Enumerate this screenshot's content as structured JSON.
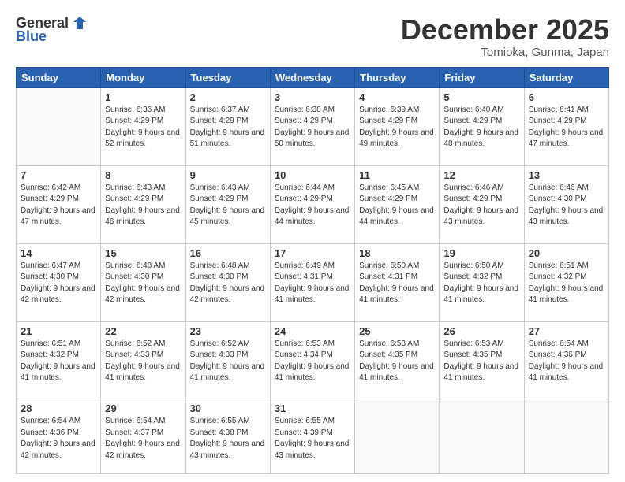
{
  "header": {
    "logo_general": "General",
    "logo_blue": "Blue",
    "month_title": "December 2025",
    "location": "Tomioka, Gunma, Japan"
  },
  "days_of_week": [
    "Sunday",
    "Monday",
    "Tuesday",
    "Wednesday",
    "Thursday",
    "Friday",
    "Saturday"
  ],
  "weeks": [
    [
      {
        "num": "",
        "sunrise": "",
        "sunset": "",
        "daylight": ""
      },
      {
        "num": "1",
        "sunrise": "Sunrise: 6:36 AM",
        "sunset": "Sunset: 4:29 PM",
        "daylight": "Daylight: 9 hours and 52 minutes."
      },
      {
        "num": "2",
        "sunrise": "Sunrise: 6:37 AM",
        "sunset": "Sunset: 4:29 PM",
        "daylight": "Daylight: 9 hours and 51 minutes."
      },
      {
        "num": "3",
        "sunrise": "Sunrise: 6:38 AM",
        "sunset": "Sunset: 4:29 PM",
        "daylight": "Daylight: 9 hours and 50 minutes."
      },
      {
        "num": "4",
        "sunrise": "Sunrise: 6:39 AM",
        "sunset": "Sunset: 4:29 PM",
        "daylight": "Daylight: 9 hours and 49 minutes."
      },
      {
        "num": "5",
        "sunrise": "Sunrise: 6:40 AM",
        "sunset": "Sunset: 4:29 PM",
        "daylight": "Daylight: 9 hours and 48 minutes."
      },
      {
        "num": "6",
        "sunrise": "Sunrise: 6:41 AM",
        "sunset": "Sunset: 4:29 PM",
        "daylight": "Daylight: 9 hours and 47 minutes."
      }
    ],
    [
      {
        "num": "7",
        "sunrise": "Sunrise: 6:42 AM",
        "sunset": "Sunset: 4:29 PM",
        "daylight": "Daylight: 9 hours and 47 minutes."
      },
      {
        "num": "8",
        "sunrise": "Sunrise: 6:43 AM",
        "sunset": "Sunset: 4:29 PM",
        "daylight": "Daylight: 9 hours and 46 minutes."
      },
      {
        "num": "9",
        "sunrise": "Sunrise: 6:43 AM",
        "sunset": "Sunset: 4:29 PM",
        "daylight": "Daylight: 9 hours and 45 minutes."
      },
      {
        "num": "10",
        "sunrise": "Sunrise: 6:44 AM",
        "sunset": "Sunset: 4:29 PM",
        "daylight": "Daylight: 9 hours and 44 minutes."
      },
      {
        "num": "11",
        "sunrise": "Sunrise: 6:45 AM",
        "sunset": "Sunset: 4:29 PM",
        "daylight": "Daylight: 9 hours and 44 minutes."
      },
      {
        "num": "12",
        "sunrise": "Sunrise: 6:46 AM",
        "sunset": "Sunset: 4:29 PM",
        "daylight": "Daylight: 9 hours and 43 minutes."
      },
      {
        "num": "13",
        "sunrise": "Sunrise: 6:46 AM",
        "sunset": "Sunset: 4:30 PM",
        "daylight": "Daylight: 9 hours and 43 minutes."
      }
    ],
    [
      {
        "num": "14",
        "sunrise": "Sunrise: 6:47 AM",
        "sunset": "Sunset: 4:30 PM",
        "daylight": "Daylight: 9 hours and 42 minutes."
      },
      {
        "num": "15",
        "sunrise": "Sunrise: 6:48 AM",
        "sunset": "Sunset: 4:30 PM",
        "daylight": "Daylight: 9 hours and 42 minutes."
      },
      {
        "num": "16",
        "sunrise": "Sunrise: 6:48 AM",
        "sunset": "Sunset: 4:30 PM",
        "daylight": "Daylight: 9 hours and 42 minutes."
      },
      {
        "num": "17",
        "sunrise": "Sunrise: 6:49 AM",
        "sunset": "Sunset: 4:31 PM",
        "daylight": "Daylight: 9 hours and 41 minutes."
      },
      {
        "num": "18",
        "sunrise": "Sunrise: 6:50 AM",
        "sunset": "Sunset: 4:31 PM",
        "daylight": "Daylight: 9 hours and 41 minutes."
      },
      {
        "num": "19",
        "sunrise": "Sunrise: 6:50 AM",
        "sunset": "Sunset: 4:32 PM",
        "daylight": "Daylight: 9 hours and 41 minutes."
      },
      {
        "num": "20",
        "sunrise": "Sunrise: 6:51 AM",
        "sunset": "Sunset: 4:32 PM",
        "daylight": "Daylight: 9 hours and 41 minutes."
      }
    ],
    [
      {
        "num": "21",
        "sunrise": "Sunrise: 6:51 AM",
        "sunset": "Sunset: 4:32 PM",
        "daylight": "Daylight: 9 hours and 41 minutes."
      },
      {
        "num": "22",
        "sunrise": "Sunrise: 6:52 AM",
        "sunset": "Sunset: 4:33 PM",
        "daylight": "Daylight: 9 hours and 41 minutes."
      },
      {
        "num": "23",
        "sunrise": "Sunrise: 6:52 AM",
        "sunset": "Sunset: 4:33 PM",
        "daylight": "Daylight: 9 hours and 41 minutes."
      },
      {
        "num": "24",
        "sunrise": "Sunrise: 6:53 AM",
        "sunset": "Sunset: 4:34 PM",
        "daylight": "Daylight: 9 hours and 41 minutes."
      },
      {
        "num": "25",
        "sunrise": "Sunrise: 6:53 AM",
        "sunset": "Sunset: 4:35 PM",
        "daylight": "Daylight: 9 hours and 41 minutes."
      },
      {
        "num": "26",
        "sunrise": "Sunrise: 6:53 AM",
        "sunset": "Sunset: 4:35 PM",
        "daylight": "Daylight: 9 hours and 41 minutes."
      },
      {
        "num": "27",
        "sunrise": "Sunrise: 6:54 AM",
        "sunset": "Sunset: 4:36 PM",
        "daylight": "Daylight: 9 hours and 41 minutes."
      }
    ],
    [
      {
        "num": "28",
        "sunrise": "Sunrise: 6:54 AM",
        "sunset": "Sunset: 4:36 PM",
        "daylight": "Daylight: 9 hours and 42 minutes."
      },
      {
        "num": "29",
        "sunrise": "Sunrise: 6:54 AM",
        "sunset": "Sunset: 4:37 PM",
        "daylight": "Daylight: 9 hours and 42 minutes."
      },
      {
        "num": "30",
        "sunrise": "Sunrise: 6:55 AM",
        "sunset": "Sunset: 4:38 PM",
        "daylight": "Daylight: 9 hours and 43 minutes."
      },
      {
        "num": "31",
        "sunrise": "Sunrise: 6:55 AM",
        "sunset": "Sunset: 4:39 PM",
        "daylight": "Daylight: 9 hours and 43 minutes."
      },
      {
        "num": "",
        "sunrise": "",
        "sunset": "",
        "daylight": ""
      },
      {
        "num": "",
        "sunrise": "",
        "sunset": "",
        "daylight": ""
      },
      {
        "num": "",
        "sunrise": "",
        "sunset": "",
        "daylight": ""
      }
    ]
  ]
}
